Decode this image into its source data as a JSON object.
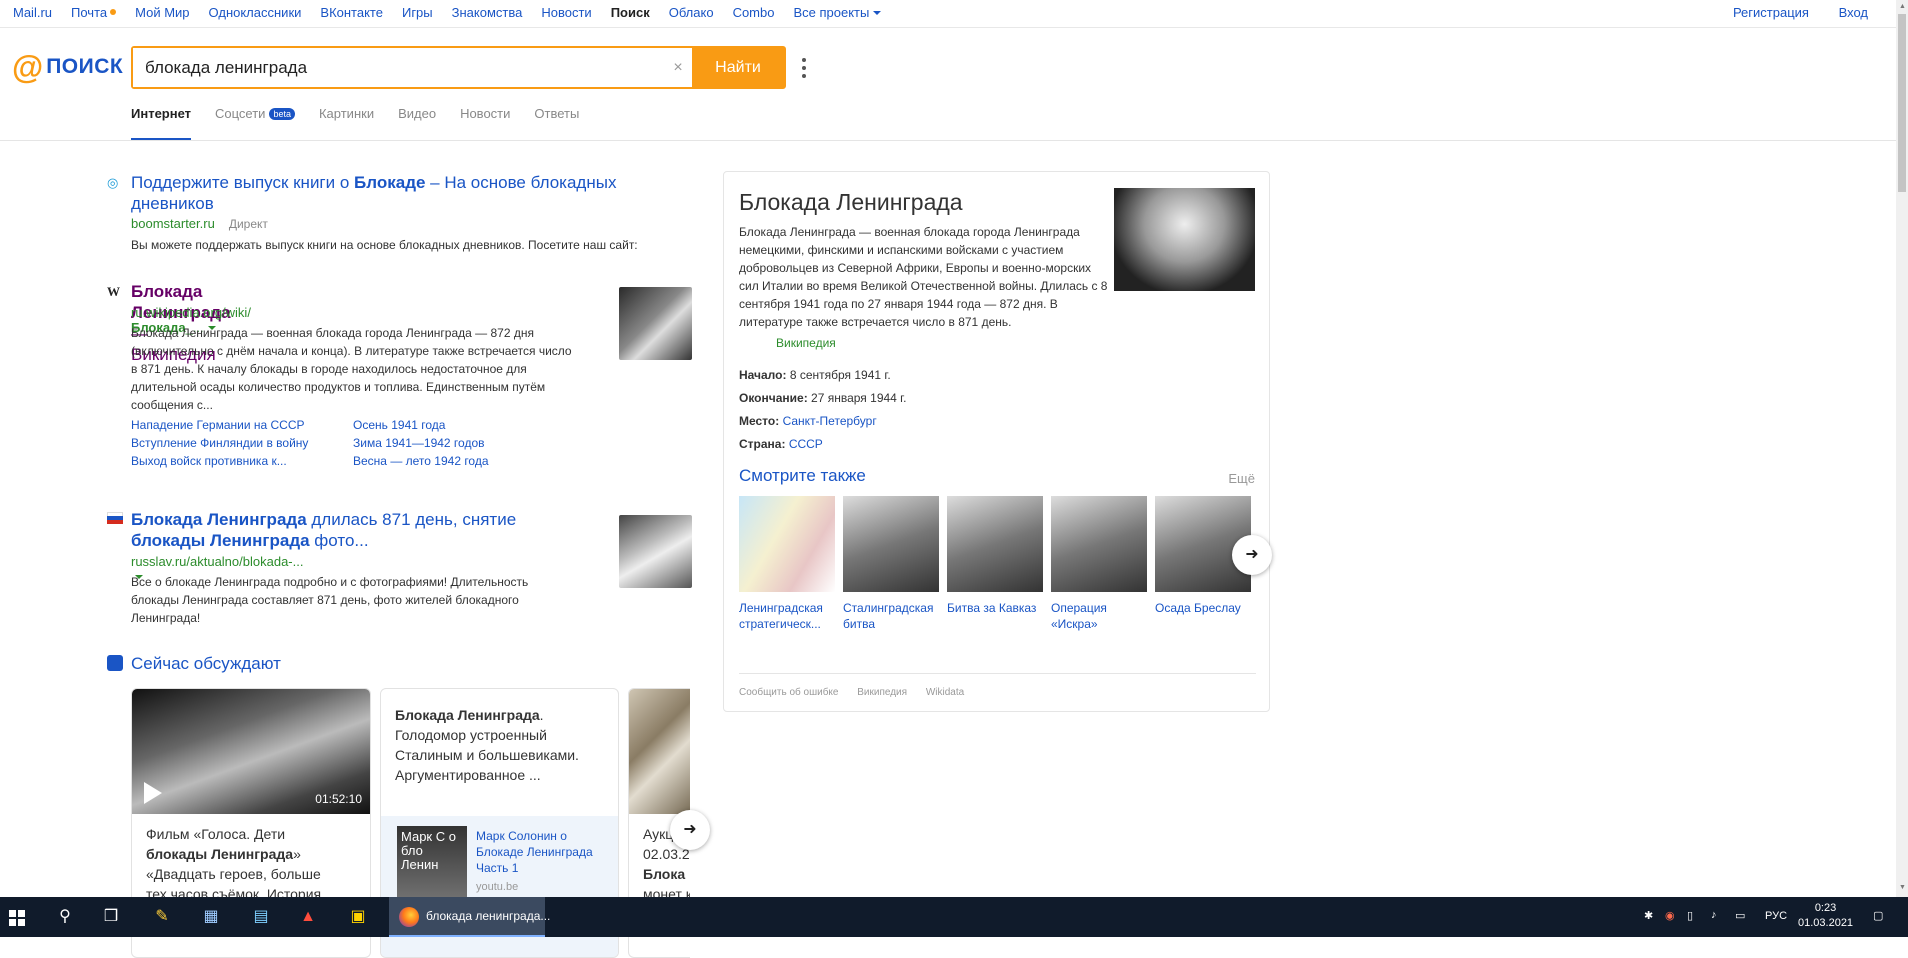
{
  "topnav": {
    "left": [
      "Mail.ru",
      "Почта",
      "Мой Мир",
      "Одноклассники",
      "ВКонтакте",
      "Игры",
      "Знакомства",
      "Новости",
      "Поиск",
      "Облако",
      "Combo",
      "Все проекты"
    ],
    "right": [
      "Регистрация",
      "Вход"
    ]
  },
  "logo": {
    "at": "@",
    "word": "ПОИСК"
  },
  "search": {
    "query": "блокада ленинграда",
    "clear": "×",
    "button": "Найти"
  },
  "tabs": [
    "Интернет",
    "Соцсети",
    "Картинки",
    "Видео",
    "Новости",
    "Ответы"
  ],
  "tabs_beta": "beta",
  "results": {
    "ad": {
      "title_a": "Поддержите выпуск книги о ",
      "title_b": "Блокаде",
      "title_c": " – На основе блокадных",
      "title_d": "дневников",
      "url": "boomstarter.ru",
      "direct": "Директ",
      "snippet": "Вы можете поддержать выпуск книги на основе блокадных дневников. Посетите наш сайт:"
    },
    "wiki": {
      "title_a": "Блокада Ленинграда",
      "title_b": " — Википедия",
      "url_a": "ru.wikipedia.org/wiki/",
      "url_b": "Блокада",
      "url_c": "_...",
      "snippet": [
        "Блокада Ленинграда — военная блокада города Ленинграда — 872 дня",
        "(включительно с днём начала и конца). В литературе также встречается число",
        "в 871 день. К началу блокады в городе находилось недостаточное для",
        "длительной осады количество продуктов и топлива. Единственным путём",
        "сообщения с..."
      ],
      "links": [
        "Нападение Германии на СССР",
        "Осень 1941 года",
        "Вступление Финляндии в войну",
        "Зима 1941—1942 годов",
        "Выход войск противника к...",
        "Весна — лето 1942 года"
      ]
    },
    "russlav": {
      "title_a": "Блокада Ленинграда",
      "title_b": " длилась 871 день, снятие",
      "title_c": "блокады Ленинграда",
      "title_d": " фото...",
      "url": "russlav.ru/aktualno/blokada-...",
      "snippet": [
        "Все о блокаде Ленинграда подробно и с фотографиями! Длительность",
        "блокады Ленинграда составляет 871 день, фото жителей блокадного",
        "Ленинграда!"
      ]
    }
  },
  "discuss": {
    "heading": "Сейчас обсуждают",
    "card1": {
      "duration": "01:52:10",
      "text_a": "Фильм «Голоса. Дети",
      "text_b": "блокады Ленинграда",
      "text_c": "»",
      "text_d": "«Двадцать героев, больше",
      "text_e": "тех часов съёмок. История"
    },
    "card2": {
      "text_a": "Блокада Ленинграда",
      "text_b": ".",
      "text_c": "Голодомор устроенный",
      "text_d": "Сталиным и большевиками.",
      "text_e": "Аргументированное ...",
      "sub_title": "Марк Солонин о Блокаде Ленинграда Часть 1",
      "sub_src": "youtu.be",
      "thumb_text": "Марк С о бло Ленин"
    },
    "card3": {
      "text_a": "Аукц",
      "text_b": "02.03.2",
      "text_c": "Блока",
      "text_d": "монет к"
    }
  },
  "kp": {
    "title": "Блокада Ленинграда",
    "desc": "Блокада Ленинграда — военная блокада города Ленинграда немецкими, финскими и испанскими войсками с участием добровольцев из Северной Африки, Европы и военно-морских сил Италии во время Великой Отечественной войны. Длилась с 8 сентября 1941 года по 27 января 1944 года — 872 дня. В литературе также встречается число в 871 день.",
    "source": "Википедия",
    "facts": [
      {
        "label": "Начало:",
        "value": "8 сентября 1941 г."
      },
      {
        "label": "Окончание:",
        "value": "27 января 1944 г."
      },
      {
        "label": "Место:",
        "value": "Санкт-Петербург"
      },
      {
        "label": "Страна:",
        "value": "СССР"
      }
    ],
    "see_also": "Смотрите также",
    "more": "Ещё",
    "items": [
      "Ленинградская стратегическ...",
      "Сталинградская битва",
      "Битва за Кавказ",
      "Операция «Искра»",
      "Осада Бреслау"
    ],
    "footer": [
      "Сообщить об ошибке",
      "Википедия",
      "Wikidata"
    ]
  },
  "taskbar": {
    "active_app": "блокада ленинграда...",
    "lang": "РУС",
    "time": "0:23",
    "date": "01.03.2021"
  }
}
